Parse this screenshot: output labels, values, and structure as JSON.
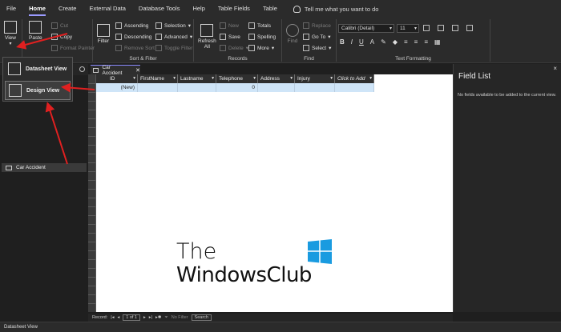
{
  "menubar": {
    "tabs": [
      {
        "label": "File"
      },
      {
        "label": "Home"
      },
      {
        "label": "Create"
      },
      {
        "label": "External Data"
      },
      {
        "label": "Database Tools"
      },
      {
        "label": "Help"
      },
      {
        "label": "Table Fields"
      },
      {
        "label": "Table"
      }
    ],
    "active_tab": "Home",
    "tellme": "Tell me what you want to do"
  },
  "ribbon": {
    "views": {
      "view": "View"
    },
    "clipboard": {
      "paste": "Paste",
      "cut": "Cut",
      "copy": "Copy",
      "format_painter": "Format Painter"
    },
    "sort_filter": {
      "label": "Sort & Filter",
      "filter": "Filter",
      "ascending": "Ascending",
      "descending": "Descending",
      "remove_sort": "Remove Sort",
      "selection": "Selection",
      "advanced": "Advanced",
      "toggle_filter": "Toggle Filter"
    },
    "records": {
      "label": "Records",
      "refresh_line1": "Refresh",
      "refresh_line2": "All",
      "new": "New",
      "save": "Save",
      "delete": "Delete",
      "totals": "Totals",
      "spelling": "Spelling",
      "more": "More"
    },
    "find": {
      "label": "Find",
      "find": "Find",
      "replace": "Replace",
      "goto": "Go To",
      "select": "Select"
    },
    "text_formatting": {
      "label": "Text Formatting",
      "font": "Calibri (Detail)",
      "size": "11",
      "bold": "B",
      "italic": "I",
      "underline": "U"
    }
  },
  "view_dropdown": {
    "datasheet_view": "Datasheet View",
    "design_view": "Design View"
  },
  "nav_pane": {
    "object": "Car Accident"
  },
  "document": {
    "tab_label": "Car Accident",
    "columns": [
      {
        "label": "ID"
      },
      {
        "label": "FirstName"
      },
      {
        "label": "Lastname"
      },
      {
        "label": "Telephone"
      },
      {
        "label": "Address"
      },
      {
        "label": "Injury"
      },
      {
        "label": "Click to Add"
      }
    ],
    "new_row": {
      "id": "(New)",
      "telephone": "0"
    }
  },
  "field_list": {
    "title": "Field List",
    "message": "No fields available to be added to the current view.",
    "close": "×"
  },
  "record_nav": {
    "label": "Record:",
    "position": "1 of 1",
    "filter": "No Filter",
    "search": "Search"
  },
  "statusbar": {
    "text": "Datasheet View"
  },
  "watermark": {
    "line1": "The",
    "line2": "WindowsClub"
  },
  "colors": {
    "annotation_arrow": "#e02020",
    "new_row_highlight": "#cfe5f8",
    "accent": "#9b9bff"
  }
}
